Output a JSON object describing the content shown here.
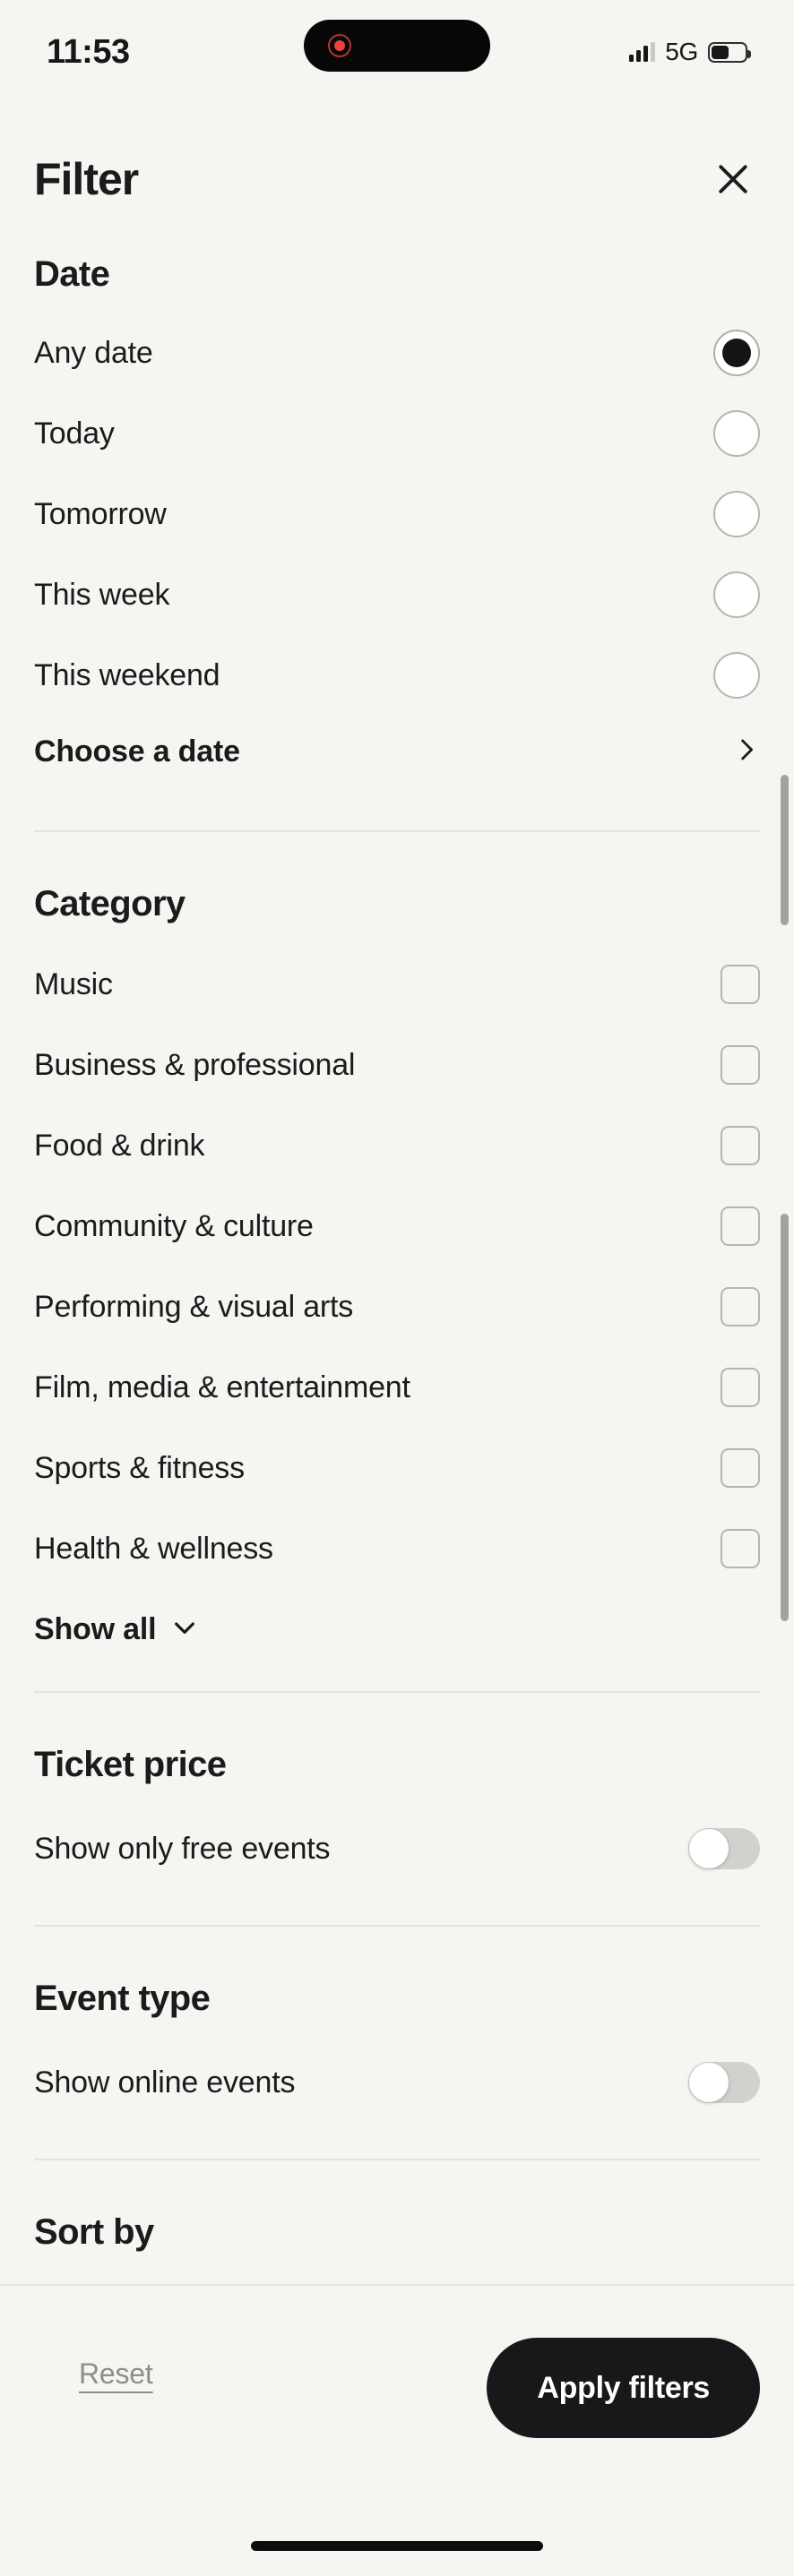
{
  "status_bar": {
    "time": "11:53",
    "network": "5G",
    "signal_icon": "signal-bars-icon",
    "battery_icon": "battery-icon",
    "recording_icon": "recording-indicator-icon"
  },
  "header": {
    "title": "Filter",
    "close_icon": "close-icon"
  },
  "sections": {
    "date": {
      "title": "Date",
      "options": [
        {
          "label": "Any date",
          "selected": true
        },
        {
          "label": "Today",
          "selected": false
        },
        {
          "label": "Tomorrow",
          "selected": false
        },
        {
          "label": "This week",
          "selected": false
        },
        {
          "label": "This weekend",
          "selected": false
        }
      ],
      "choose_date": {
        "label": "Choose a date",
        "chevron_icon": "chevron-right-icon"
      }
    },
    "category": {
      "title": "Category",
      "options": [
        {
          "label": "Music",
          "checked": false
        },
        {
          "label": "Business & professional",
          "checked": false
        },
        {
          "label": "Food & drink",
          "checked": false
        },
        {
          "label": "Community & culture",
          "checked": false
        },
        {
          "label": "Performing & visual arts",
          "checked": false
        },
        {
          "label": "Film, media & entertainment",
          "checked": false
        },
        {
          "label": "Sports & fitness",
          "checked": false
        },
        {
          "label": "Health & wellness",
          "checked": false
        }
      ],
      "show_all": {
        "label": "Show all",
        "chevron_icon": "chevron-down-icon"
      }
    },
    "ticket_price": {
      "title": "Ticket price",
      "toggle_label": "Show only free events",
      "toggle_on": false
    },
    "event_type": {
      "title": "Event type",
      "toggle_label": "Show online events",
      "toggle_on": false
    },
    "sort_by": {
      "title": "Sort by"
    }
  },
  "footer": {
    "reset_label": "Reset",
    "apply_label": "Apply filters"
  },
  "colors": {
    "background": "#f6f5f1",
    "text": "#1b1b1d",
    "accent": "#18181a",
    "muted": "#8f8e8a",
    "border": "#b6b5b2",
    "divider": "#e3e2de",
    "toggle_track": "#d2d1cd",
    "recording_red": "#e8453c"
  }
}
